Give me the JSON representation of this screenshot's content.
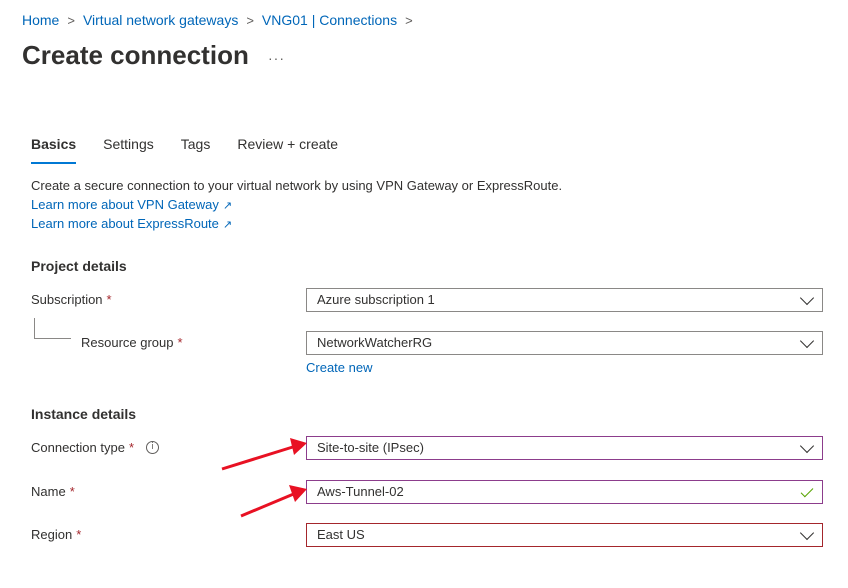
{
  "breadcrumb": {
    "items": [
      "Home",
      "Virtual network gateways",
      "VNG01 | Connections"
    ],
    "separator": ">"
  },
  "page": {
    "title": "Create connection",
    "more": "···"
  },
  "tabs": [
    "Basics",
    "Settings",
    "Tags",
    "Review + create"
  ],
  "intro": {
    "description": "Create a secure connection to your virtual network by using VPN Gateway or ExpressRoute.",
    "link_vpn": "Learn more about VPN Gateway",
    "link_er": "Learn more about ExpressRoute",
    "external_glyph": "↗"
  },
  "project": {
    "heading": "Project details",
    "subscription_label": "Subscription",
    "subscription_value": "Azure subscription 1",
    "rg_label": "Resource group",
    "rg_value": "NetworkWatcherRG",
    "create_new": "Create new"
  },
  "instance": {
    "heading": "Instance details",
    "conn_type_label": "Connection type",
    "conn_type_value": "Site-to-site (IPsec)",
    "name_label": "Name",
    "name_value": "Aws-Tunnel-02",
    "region_label": "Region",
    "region_value": "East US",
    "info_glyph": "i"
  },
  "required_mark": "*",
  "colors": {
    "link": "#0066b8",
    "accent_tab": "#0078d4",
    "required": "#a4262c",
    "annotation_arrow": "#e81123",
    "valid_check": "#57a300"
  }
}
